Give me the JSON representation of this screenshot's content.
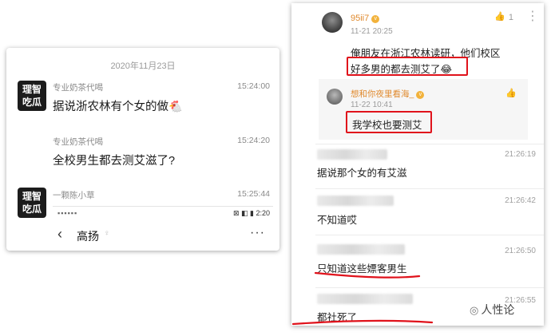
{
  "left": {
    "date": "2020年11月23日",
    "brand": [
      "理智",
      "吃瓜"
    ],
    "messages": [
      {
        "sender": "专业奶茶代喝",
        "time": "15:24:00",
        "text": "据说浙农林有个女的做",
        "emoji": "🐔"
      },
      {
        "sender": "专业奶茶代喝",
        "time": "15:24:20",
        "text": "全校男生都去测艾滋了?"
      },
      {
        "sender": "一颗陈小草",
        "time": "15:25:44"
      }
    ],
    "inner": {
      "status_time": "2:20",
      "nav_title": "高扬",
      "nav_sub": "♀",
      "more": "···"
    }
  },
  "right": {
    "comment": {
      "user": "95ii7",
      "date": "11-21 20:25",
      "likes": "1",
      "text1": "俺朋友在浙江农林读研，他们校区",
      "text2": "好多男的都去测艾了",
      "emoji": "😂"
    },
    "reply": {
      "user": "想和你夜里看海_",
      "date": "11-22 10:41",
      "text": "我学校也要测艾"
    },
    "rows": [
      {
        "time": "21:26:19",
        "text": "据说那个女的有艾滋"
      },
      {
        "time": "21:26:42",
        "text": "不知道哎"
      },
      {
        "time": "21:26:50",
        "text": "只知道这些嫖客男生"
      },
      {
        "time": "21:26:55",
        "text": "都社死了"
      }
    ]
  },
  "watermark": "人性论",
  "colors": {
    "accent_red": "#e0121b",
    "username": "#e08a2e",
    "badge": "#1c1c1c"
  }
}
